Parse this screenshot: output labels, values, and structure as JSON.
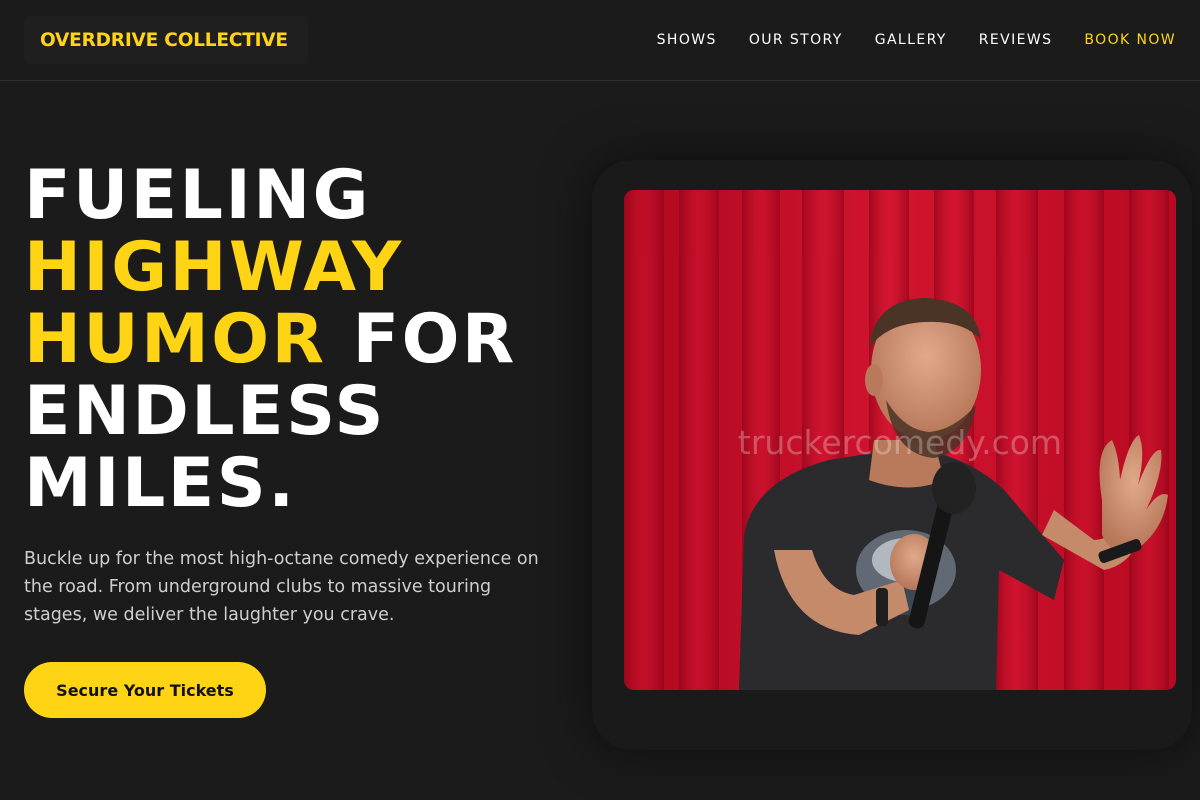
{
  "header": {
    "logo": "OVERDRIVE COLLECTIVE",
    "nav": [
      {
        "label": "SHOWS"
      },
      {
        "label": "OUR STORY"
      },
      {
        "label": "GALLERY"
      },
      {
        "label": "REVIEWS"
      },
      {
        "label": "BOOK NOW"
      }
    ]
  },
  "hero": {
    "title_1": "FUELING",
    "title_2": "HIGHWAY",
    "title_3": "HUMOR",
    "title_4": " FOR",
    "title_5": "ENDLESS",
    "title_6": "MILES.",
    "subtitle": "Buckle up for the most high-octane comedy experience on the road. From underground clubs to massive touring stages, we deliver the laughter you crave.",
    "cta_label": "Secure Your Tickets"
  },
  "media": {
    "watermark": "truckercomedy.com",
    "icon": "comedian-photo"
  },
  "colors": {
    "accent": "#ffd414",
    "background": "#1b1b1c",
    "curtain": "#c8102e"
  }
}
